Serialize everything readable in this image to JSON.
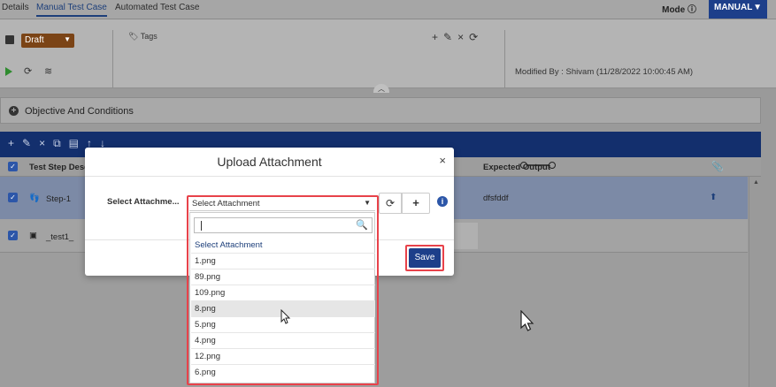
{
  "tabs": [
    {
      "label": "Details"
    },
    {
      "label": "Manual Test Case",
      "active": true
    },
    {
      "label": "Automated Test Case"
    }
  ],
  "mode": {
    "label": "Mode",
    "value": "MANUAL"
  },
  "toolbar": {
    "status": "Draft",
    "tags_label": "Tags",
    "modified": "Modified By : Shivam (11/28/2022 10:00:45 AM)"
  },
  "objective": {
    "label": "Objective And Conditions"
  },
  "grid": {
    "col_desc": "Test Step Desc",
    "col_expected": "Expected Output",
    "rows": [
      {
        "label": "Step-1",
        "expected": "dfsfddf"
      },
      {
        "label": "_test1_",
        "expected": ""
      }
    ]
  },
  "modal": {
    "title": "Upload Attachment",
    "close": "×",
    "select_label": "Select Attachme...",
    "selected": "Select Attachment",
    "save_label": "Save"
  },
  "dropdown": {
    "search_value": "",
    "options": [
      "Select Attachment",
      "1.png",
      "89.png",
      "109.png",
      "8.png",
      "5.png",
      "4.png",
      "12.png",
      "6.png"
    ],
    "hovered": "8.png"
  },
  "colors": {
    "brand": "#1d3f8a",
    "highlight": "#e8424a",
    "status_draft": "#7b4416"
  }
}
